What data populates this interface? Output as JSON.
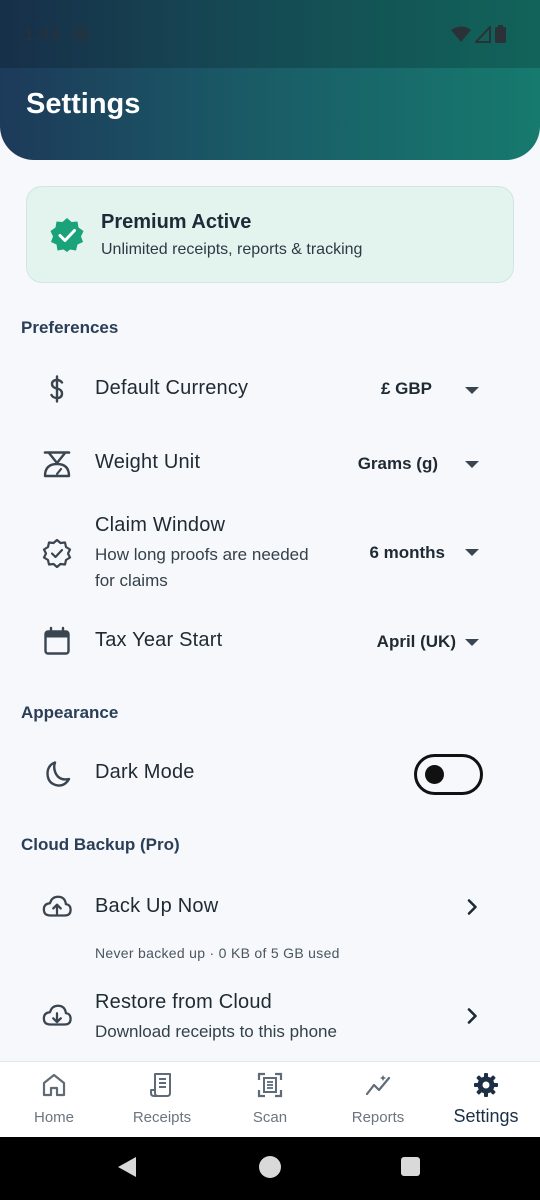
{
  "status_bar": {
    "time": "1:43"
  },
  "header": {
    "title": "Settings"
  },
  "premium": {
    "title": "Premium Active",
    "subtitle": "Unlimited receipts, reports & tracking",
    "icon": "verified-badge-icon",
    "color": "#1aa37a"
  },
  "sections": {
    "preferences": "Preferences",
    "appearance": "Appearance",
    "cloud": "Cloud Backup (Pro)"
  },
  "preferences": {
    "currency": {
      "label": "Default Currency",
      "value": "£ GBP",
      "icon": "dollar-icon"
    },
    "weight": {
      "label": "Weight Unit",
      "value": "Grams (g)",
      "icon": "scale-icon"
    },
    "claim": {
      "label": "Claim Window",
      "subtitle_line1": "How long proofs are needed",
      "subtitle_line2": "for claims",
      "value": "6 months",
      "icon": "badge-check-icon"
    },
    "tax": {
      "label": "Tax Year Start",
      "value": "April (UK)",
      "icon": "calendar-icon"
    }
  },
  "appearance": {
    "dark_mode": {
      "label": "Dark Mode",
      "enabled": false,
      "icon": "moon-icon"
    }
  },
  "cloud": {
    "backup": {
      "label": "Back Up Now",
      "note": "Never backed up · 0 KB of 5 GB used",
      "icon": "cloud-upload-icon"
    },
    "restore": {
      "label": "Restore from Cloud",
      "subtitle": "Download receipts to this phone",
      "icon": "cloud-download-icon"
    }
  },
  "bottom_nav": {
    "items": [
      {
        "label": "Home",
        "icon": "home-icon"
      },
      {
        "label": "Receipts",
        "icon": "receipt-icon"
      },
      {
        "label": "Scan",
        "icon": "scan-icon"
      },
      {
        "label": "Reports",
        "icon": "chart-icon"
      },
      {
        "label": "Settings",
        "icon": "gear-icon"
      }
    ],
    "active": "Settings"
  }
}
